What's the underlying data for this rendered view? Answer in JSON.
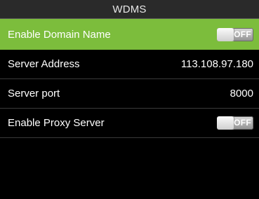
{
  "header": {
    "title": "WDMS"
  },
  "settings": [
    {
      "label": "Enable Domain Name",
      "type": "toggle",
      "state": "OFF"
    },
    {
      "label": "Server Address",
      "type": "value",
      "value": "113.108.97.180"
    },
    {
      "label": "Server port",
      "type": "value",
      "value": "8000"
    },
    {
      "label": "Enable Proxy Server",
      "type": "toggle",
      "state": "OFF"
    }
  ],
  "colors": {
    "selected_row": "#7cbd3c",
    "background": "#000000",
    "title_bar": "#2a2a2a"
  }
}
